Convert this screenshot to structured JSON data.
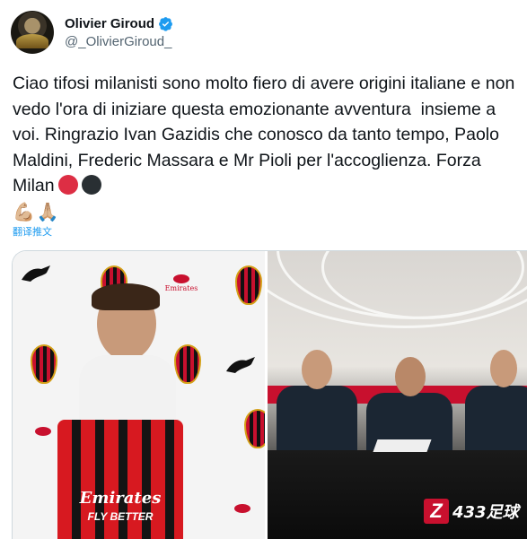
{
  "author": {
    "display_name": "Olivier Giroud",
    "handle": "@_OlivierGiroud_",
    "verified_icon": "verified-badge-icon"
  },
  "tweet": {
    "text": "Ciao tifosi milanisti sono molto fiero di avere origini italiane e non vedo l'ora di iniziare questa emozionante avventura  insieme a voi. Ringrazio Ivan Gazidis che conosco da tanto tempo, Paolo Maldini, Frederic Massara e Mr Pioli per l'accoglienza. Forza Milan",
    "emojis": [
      "💪🏼",
      "🙏🏼"
    ],
    "translate_label": "翻译推文"
  },
  "media": {
    "left_photo": {
      "jersey_sponsor": "Emirates",
      "jersey_tagline": "FLY BETTER",
      "backdrop_sponsor": "Emirates"
    },
    "right_photo": {}
  },
  "watermark": {
    "logo": "Z",
    "text": "433足球"
  },
  "colors": {
    "accent": "#1d9bf0",
    "milan_red": "#dd2e44",
    "milan_black": "#292f33"
  }
}
